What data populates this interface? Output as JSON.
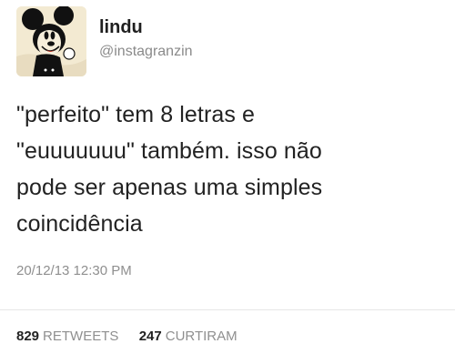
{
  "user": {
    "display_name": "lindu",
    "handle": "@instagranzin"
  },
  "tweet": {
    "lines": [
      "\"perfeito\" tem 8 letras e",
      "\"euuuuuuu\" também. isso não",
      "pode ser apenas uma simples",
      "coincidência"
    ],
    "timestamp": "20/12/13 12:30 PM"
  },
  "stats": {
    "retweets_count": "829",
    "retweets_label": "RETWEETS",
    "likes_count": "247",
    "likes_label": "CURTIRAM"
  },
  "colors": {
    "text": "#222222",
    "muted": "#8f8f8f",
    "divider": "#e6e6e6"
  }
}
